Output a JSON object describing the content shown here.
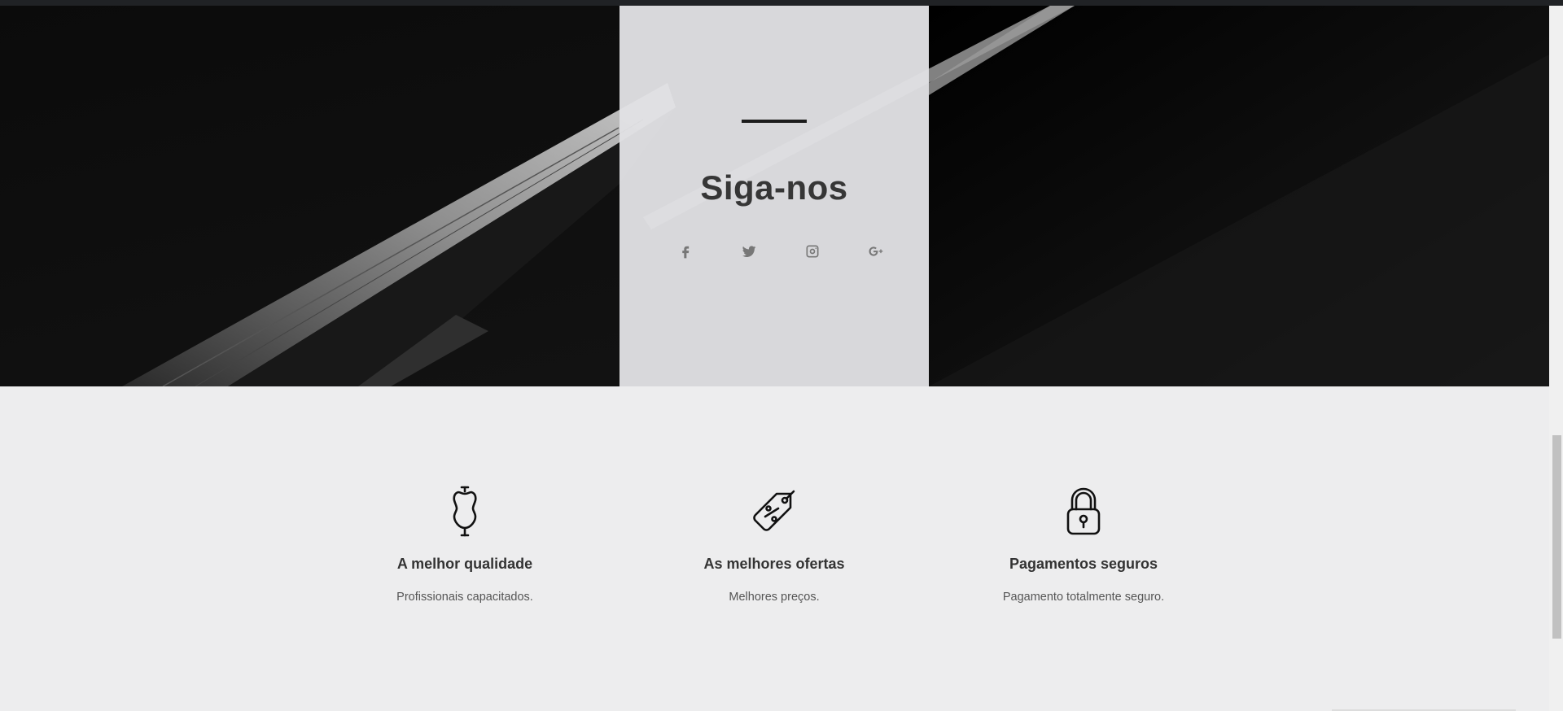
{
  "follow": {
    "title": "Siga-nos",
    "social": [
      {
        "name": "facebook-icon",
        "label": ""
      },
      {
        "name": "twitter-icon",
        "label": ""
      },
      {
        "name": "instagram-icon",
        "label": ""
      },
      {
        "name": "google-plus-icon",
        "label": ""
      }
    ]
  },
  "features": [
    {
      "icon": "dress-form-icon",
      "title": "A melhor qualidade",
      "text": "Profissionais capacitados."
    },
    {
      "icon": "discount-tag-icon",
      "title": "As melhores ofertas",
      "text": "Melhores preços."
    },
    {
      "icon": "padlock-icon",
      "title": "Pagamentos seguros",
      "text": "Pagamento totalmente seguro."
    }
  ],
  "colors": {
    "hero_background": "#050505",
    "card_background": "#e1e1e4",
    "page_background": "#ededee",
    "title_color": "#363636"
  }
}
